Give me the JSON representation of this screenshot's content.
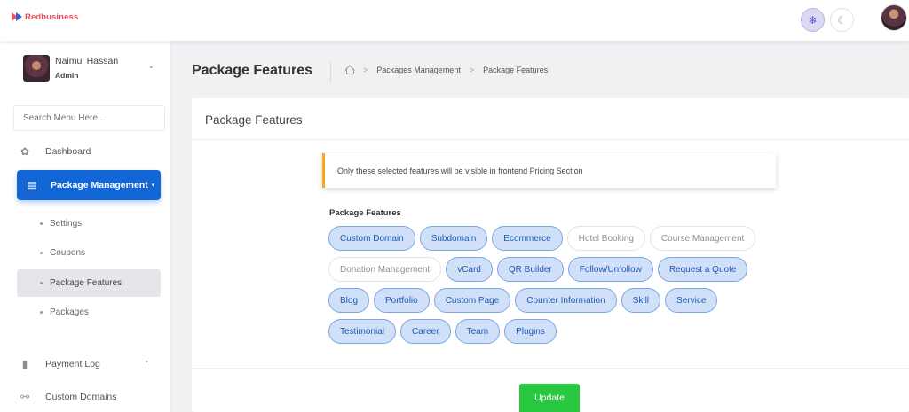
{
  "app": {
    "brand": "Redbusiness"
  },
  "topbar": {
    "light_icon": "sun-icon",
    "dark_icon": "moon-icon",
    "light_glyph": "❄",
    "dark_glyph": "☾"
  },
  "user": {
    "name": "Naimul Hassan",
    "role": "Admin",
    "caret": "⌄"
  },
  "sidebar": {
    "search_placeholder": "Search Menu Here...",
    "items": [
      {
        "label": "Dashboard",
        "icon": "dashboard-icon",
        "glyph": "✿"
      },
      {
        "label": "Package Management",
        "icon": "document-icon",
        "glyph": "▤",
        "caret": "▾"
      },
      {
        "label": "Payment Log",
        "icon": "receipt-icon",
        "glyph": "▮"
      },
      {
        "label": "Custom Domains",
        "icon": "link-icon",
        "glyph": "⚯",
        "caret": "⌄"
      }
    ],
    "sub_items": [
      {
        "label": "Settings"
      },
      {
        "label": "Coupons"
      },
      {
        "label": "Package Features"
      },
      {
        "label": "Packages"
      }
    ]
  },
  "header": {
    "title": "Package Features",
    "breadcrumb": [
      "Packages Management",
      "Package Features"
    ],
    "sep": ">"
  },
  "card": {
    "title": "Package Features",
    "alert": "Only these selected features will be visible in frontend Pricing Section",
    "features_label": "Package Features",
    "features": [
      {
        "label": "Custom Domain",
        "selected": true
      },
      {
        "label": "Subdomain",
        "selected": true
      },
      {
        "label": "Ecommerce",
        "selected": true
      },
      {
        "label": "Hotel Booking",
        "selected": false
      },
      {
        "label": "Course Management",
        "selected": false
      },
      {
        "label": "Donation Management",
        "selected": false
      },
      {
        "label": "vCard",
        "selected": true
      },
      {
        "label": "QR Builder",
        "selected": true
      },
      {
        "label": "Follow/Unfollow",
        "selected": true
      },
      {
        "label": "Request a Quote",
        "selected": true
      },
      {
        "label": "Blog",
        "selected": true
      },
      {
        "label": "Portfolio",
        "selected": true
      },
      {
        "label": "Custom Page",
        "selected": true
      },
      {
        "label": "Counter Information",
        "selected": true
      },
      {
        "label": "Skill",
        "selected": true
      },
      {
        "label": "Service",
        "selected": true
      },
      {
        "label": "Testimonial",
        "selected": true
      },
      {
        "label": "Career",
        "selected": true
      },
      {
        "label": "Team",
        "selected": true
      },
      {
        "label": "Plugins",
        "selected": true
      }
    ],
    "update_label": "Update"
  },
  "colors": {
    "primary": "#1266d6",
    "success": "#28c840",
    "warning": "#f5a623",
    "brand": "#e84a5a"
  }
}
